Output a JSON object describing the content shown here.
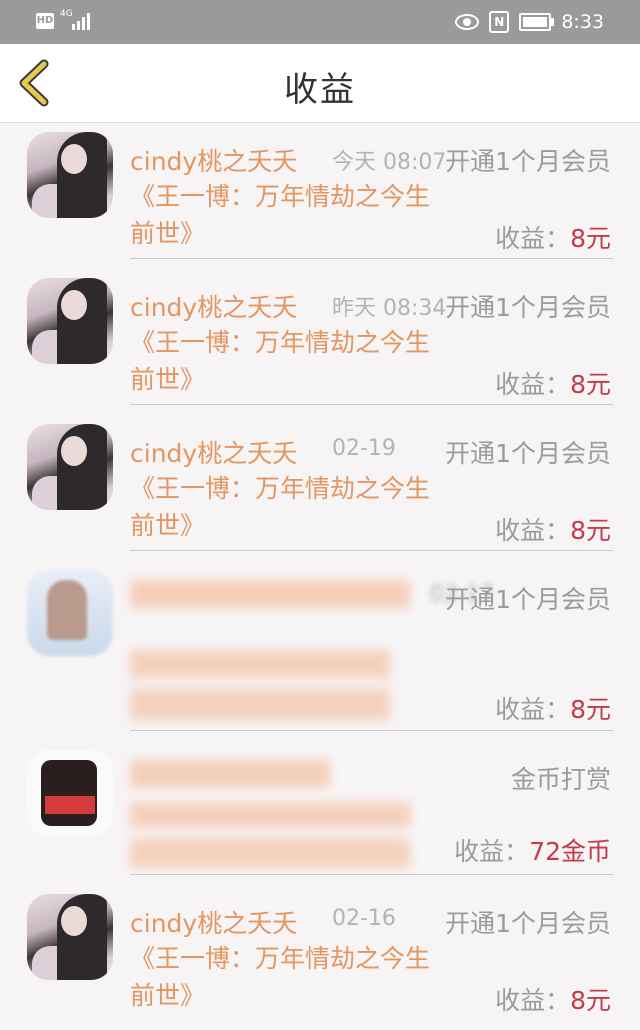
{
  "status_bar": {
    "hd": "HD",
    "network": "4G",
    "time": "8:33"
  },
  "header": {
    "title": "收益"
  },
  "colors": {
    "accent_orange": "#e39660",
    "amount_red": "#c33a4a",
    "back_arrow": "#e8c94b"
  },
  "items": [
    {
      "name": "cindy桃之夭夭",
      "time": "今天 08:07",
      "desc": "开通1个月会员",
      "book": "《王一博：万年情劫之今生前世》",
      "income_label": "收益：",
      "amount": "8元"
    },
    {
      "name": "cindy桃之夭夭",
      "time": "昨天 08:34",
      "desc": "开通1个月会员",
      "book": "《王一博：万年情劫之今生前世》",
      "income_label": "收益：",
      "amount": "8元"
    },
    {
      "name": "cindy桃之夭夭",
      "time": "02-19",
      "desc": "开通1个月会员",
      "book": "《王一博：万年情劫之今生前世》",
      "income_label": "收益：",
      "amount": "8元"
    },
    {
      "name": "",
      "time": "02-17",
      "desc": "开通1个月会员",
      "book": "",
      "income_label": "收益：",
      "amount": "8元"
    },
    {
      "name": "",
      "time": "",
      "desc": "金币打赏",
      "book": "",
      "income_label": "收益：",
      "amount": "72金币"
    },
    {
      "name": "cindy桃之夭夭",
      "time": "02-16",
      "desc": "开通1个月会员",
      "book": "《王一博：万年情劫之今生前世》",
      "income_label": "收益：",
      "amount": "8元"
    }
  ]
}
